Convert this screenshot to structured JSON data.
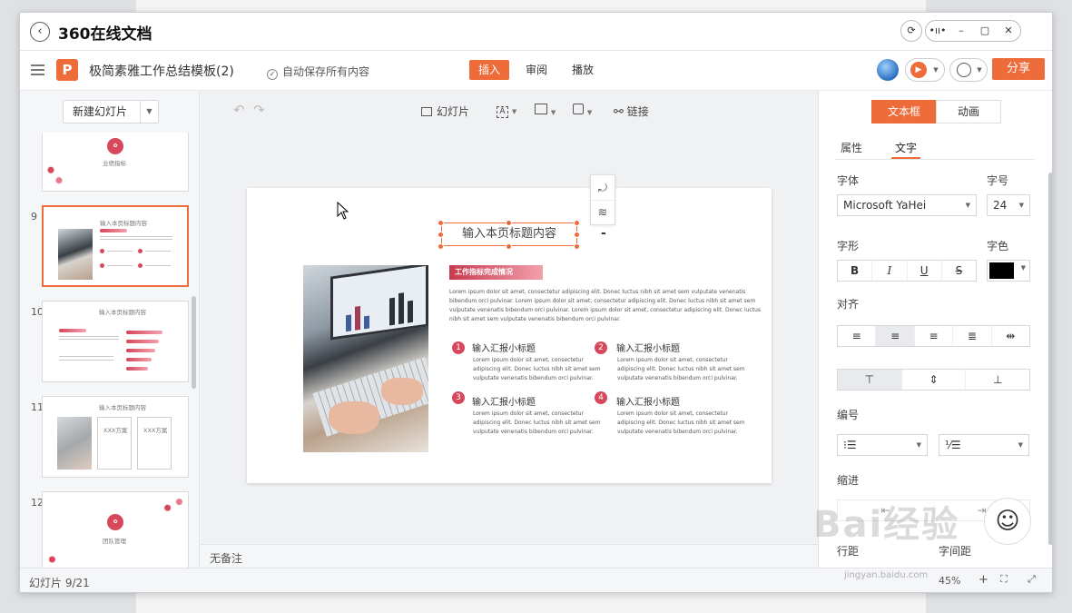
{
  "app": {
    "title": "360在线文档",
    "window_buttons": [
      "⟳",
      "•ıı•",
      "–",
      "▢",
      "✕"
    ]
  },
  "header": {
    "doc_name": "极简素雅工作总结模板(2)",
    "autosave": "自动保存所有内容",
    "tabs": [
      {
        "label": "插入",
        "active": true
      },
      {
        "label": "审阅",
        "active": false
      },
      {
        "label": "播放",
        "active": false
      }
    ],
    "share_label": "分享",
    "accent_color": "#ee6b3a"
  },
  "left_panel": {
    "new_slide_label": "新建幻灯片",
    "thumbnails": [
      {
        "number": "",
        "caption": "业绩指标"
      },
      {
        "number": "9",
        "caption": "输入本页标题内容",
        "selected": true
      },
      {
        "number": "10",
        "caption": "输入本页标题内容"
      },
      {
        "number": "11",
        "caption": "输入本页标题内容",
        "box1": "XXX方案",
        "box2": "XXX方案"
      },
      {
        "number": "12",
        "caption": "团队管理"
      }
    ]
  },
  "canvas_toolbar": {
    "slide_label": "幻灯片",
    "link_label": "链接"
  },
  "slide": {
    "title": "输入本页标题内容",
    "tag": "工作指标完成情况",
    "lorem_lines": [
      "Lorem ipsum dolor sit amet, consectetur adipiscing elit. Donec luctus nibh sit amet sem vulputate venenatis",
      "bibendum orci pulvinar. Lorem ipsum dolor sit amet, consectetur adipiscing elit. Donec luctus nibh sit amet sem",
      "vulputate venenatis bibendum orci pulvinar. Lorem ipsum dolor sit amet, consectetur adipiscing elit. Donec luctus",
      "nibh sit amet sem vulputate venenatis bibendum orci pulvinar."
    ],
    "items": [
      {
        "num": "1",
        "title": "输入汇报小标题"
      },
      {
        "num": "2",
        "title": "输入汇报小标题"
      },
      {
        "num": "3",
        "title": "输入汇报小标题"
      },
      {
        "num": "4",
        "title": "输入汇报小标题"
      }
    ],
    "item_lorem": [
      "Lorem ipsum dolor sit amet, consectetur",
      "adipiscing elit. Donec luctus nibh sit amet sem",
      "vulputate venenatis bibendum orci pulvinar."
    ],
    "minus_label": "-"
  },
  "notes": {
    "label": "无备注"
  },
  "status": {
    "slide_count": "幻灯片 9/21",
    "zoom": "45%"
  },
  "right_panel": {
    "tabs": [
      {
        "label": "文本框",
        "active": true
      },
      {
        "label": "动画",
        "active": false
      }
    ],
    "subtabs": [
      {
        "label": "属性"
      },
      {
        "label": "文字",
        "active": true
      }
    ],
    "font_label": "字体",
    "font_value": "Microsoft YaHei",
    "size_label": "字号",
    "size_value": "24",
    "style_label": "字形",
    "color_label": "字色",
    "align_label": "对齐",
    "numbering_label": "编号",
    "indent_label": "缩进",
    "line_spacing_label": "行距",
    "para_spacing_label": "字间距",
    "font_color": "#000000"
  },
  "watermark": {
    "text": "Bai经验",
    "url": "jingyan.baidu.com"
  }
}
